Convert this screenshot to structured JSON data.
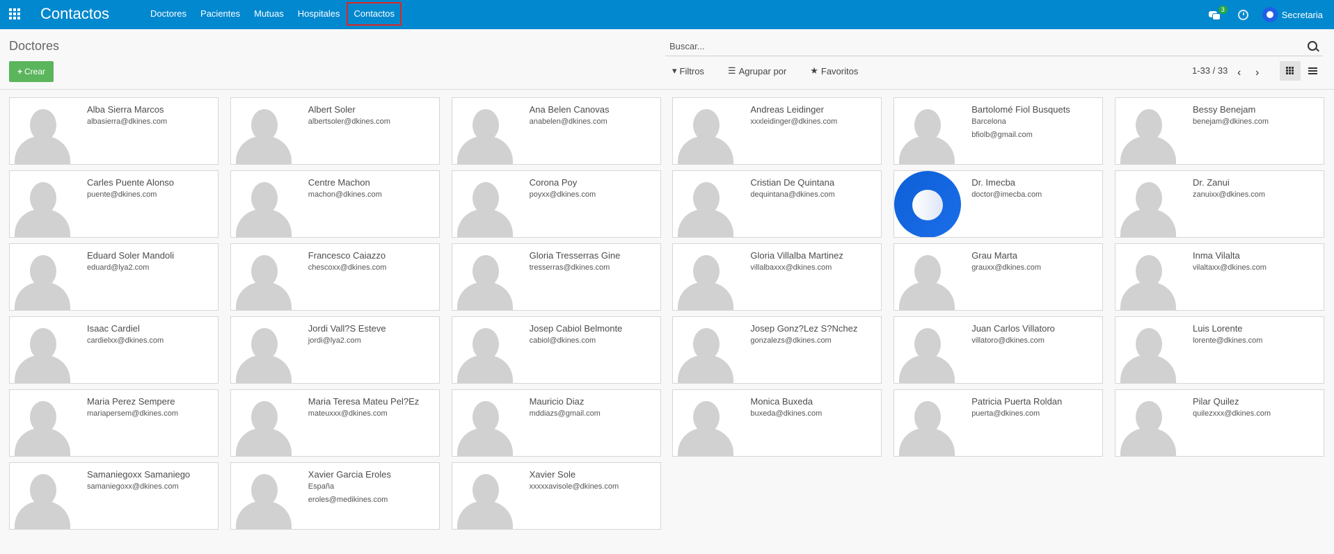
{
  "app": {
    "title": "Contactos"
  },
  "menu": [
    {
      "label": "Doctores",
      "active": false
    },
    {
      "label": "Pacientes",
      "active": false
    },
    {
      "label": "Mutuas",
      "active": false
    },
    {
      "label": "Hospitales",
      "active": false
    },
    {
      "label": "Contactos",
      "active": true
    }
  ],
  "systray": {
    "chat_badge": "3",
    "user": "Secretaria"
  },
  "control": {
    "title": "Doctores",
    "create_label": "Crear",
    "search_placeholder": "Buscar...",
    "filters_label": "Filtros",
    "groupby_label": "Agrupar por",
    "favorites_label": "Favoritos",
    "pager": "1-33 / 33"
  },
  "contacts": [
    {
      "name": "Alba Sierra Marcos",
      "lines": [
        "albasierra@dkines.com"
      ]
    },
    {
      "name": "Albert Soler",
      "lines": [
        "albertsoler@dkines.com"
      ]
    },
    {
      "name": "Ana Belen Canovas",
      "lines": [
        "anabelen@dkines.com"
      ]
    },
    {
      "name": "Andreas Leidinger",
      "lines": [
        "xxxleidinger@dkines.com"
      ]
    },
    {
      "name": "Bartolomé Fiol Busquets",
      "lines": [
        "Barcelona",
        "bfiolb@gmail.com"
      ]
    },
    {
      "name": "Bessy Benejam",
      "lines": [
        "benejam@dkines.com"
      ]
    },
    {
      "name": "Carles Puente Alonso",
      "lines": [
        "puente@dkines.com"
      ]
    },
    {
      "name": "Centre Machon",
      "lines": [
        "machon@dkines.com"
      ]
    },
    {
      "name": "Corona Poy",
      "lines": [
        "poyxx@dkines.com"
      ]
    },
    {
      "name": "Cristian De Quintana",
      "lines": [
        "dequintana@dkines.com"
      ]
    },
    {
      "name": "Dr. Imecba",
      "lines": [
        "doctor@imecba.com"
      ],
      "custom_avatar": true
    },
    {
      "name": "Dr. Zanui",
      "lines": [
        "zanuixx@dkines.com"
      ]
    },
    {
      "name": "Eduard Soler Mandoli",
      "lines": [
        "eduard@lya2.com"
      ]
    },
    {
      "name": "Francesco Caiazzo",
      "lines": [
        "chescoxx@dkines.com"
      ]
    },
    {
      "name": "Gloria Tresserras Gine",
      "lines": [
        "tresserras@dkines.com"
      ]
    },
    {
      "name": "Gloria Villalba Martinez",
      "lines": [
        "villalbaxxx@dkines.com"
      ]
    },
    {
      "name": "Grau Marta",
      "lines": [
        "grauxx@dkines.com"
      ]
    },
    {
      "name": "Inma Vilalta",
      "lines": [
        "vilaltaxx@dkines.com"
      ]
    },
    {
      "name": "Isaac Cardiel",
      "lines": [
        "cardielxx@dkines.com"
      ]
    },
    {
      "name": "Jordi Vall?S Esteve",
      "lines": [
        "jordi@lya2.com"
      ]
    },
    {
      "name": "Josep Cabiol Belmonte",
      "lines": [
        "cabiol@dkines.com"
      ]
    },
    {
      "name": "Josep Gonz?Lez S?Nchez",
      "lines": [
        "gonzalezs@dkines.com"
      ]
    },
    {
      "name": "Juan Carlos Villatoro",
      "lines": [
        "villatoro@dkines.com"
      ]
    },
    {
      "name": "Luis Lorente",
      "lines": [
        "lorente@dkines.com"
      ]
    },
    {
      "name": "Maria Perez Sempere",
      "lines": [
        "mariapersem@dkines.com"
      ]
    },
    {
      "name": "Maria Teresa Mateu Pel?Ez",
      "lines": [
        "mateuxxx@dkines.com"
      ]
    },
    {
      "name": "Mauricio Diaz",
      "lines": [
        "mddiazs@gmail.com"
      ]
    },
    {
      "name": "Monica Buxeda",
      "lines": [
        "buxeda@dkines.com"
      ]
    },
    {
      "name": "Patricia Puerta Roldan",
      "lines": [
        "puerta@dkines.com"
      ]
    },
    {
      "name": "Pilar Quilez",
      "lines": [
        "quilezxxx@dkines.com"
      ]
    },
    {
      "name": "Samaniegoxx Samaniego",
      "lines": [
        "samaniegoxx@dkines.com"
      ]
    },
    {
      "name": "Xavier Garcia Eroles",
      "lines": [
        "España",
        "eroles@medikines.com"
      ]
    },
    {
      "name": "Xavier Sole",
      "lines": [
        "xxxxxavisole@dkines.com"
      ]
    }
  ]
}
